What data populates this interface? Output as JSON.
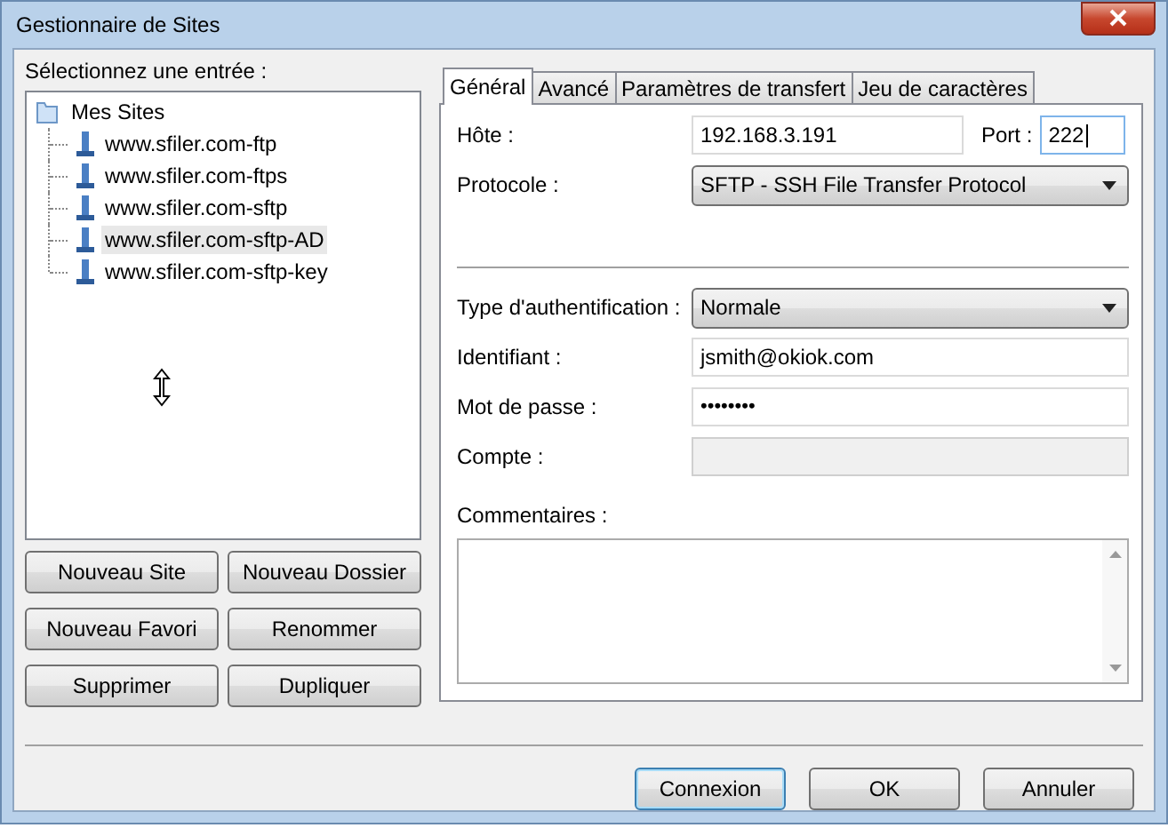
{
  "window": {
    "title": "Gestionnaire de Sites"
  },
  "site_list": {
    "label": "Sélectionnez une entrée :",
    "root": {
      "label": "Mes Sites",
      "children": [
        {
          "label": "www.sfiler.com-ftp",
          "selected": false
        },
        {
          "label": "www.sfiler.com-ftps",
          "selected": false
        },
        {
          "label": "www.sfiler.com-sftp",
          "selected": false
        },
        {
          "label": "www.sfiler.com-sftp-AD",
          "selected": true
        },
        {
          "label": "www.sfiler.com-sftp-key",
          "selected": false
        }
      ]
    }
  },
  "site_buttons": [
    "Nouveau Site",
    "Nouveau Dossier",
    "Nouveau Favori",
    "Renommer",
    "Supprimer",
    "Dupliquer"
  ],
  "tabs": [
    {
      "label": "Général",
      "selected": true
    },
    {
      "label": "Avancé",
      "selected": false
    },
    {
      "label": "Paramètres de transfert",
      "selected": false
    },
    {
      "label": "Jeu de caractères",
      "selected": false
    }
  ],
  "host": {
    "label": "Hôte :",
    "value": "192.168.3.191",
    "port_label": "Port :",
    "port_value": "222"
  },
  "protocol": {
    "label": "Protocole :",
    "value": "SFTP - SSH File Transfer Protocol"
  },
  "auth_fields": [
    {
      "kind": "select",
      "label": "Type d'authentification :",
      "value": "Normale",
      "disabled": false
    },
    {
      "kind": "text",
      "label": "Identifiant :",
      "value": "jsmith@okiok.com",
      "disabled": false
    },
    {
      "kind": "password",
      "label": "Mot de passe :",
      "value": "••••••••",
      "disabled": false
    },
    {
      "kind": "text",
      "label": "Compte :",
      "disabled": true
    }
  ],
  "comments": {
    "label": "Commentaires :"
  },
  "footer_buttons": [
    {
      "label": "Connexion",
      "default": true
    },
    {
      "label": "OK",
      "default": false
    },
    {
      "label": "Annuler",
      "default": false
    }
  ]
}
